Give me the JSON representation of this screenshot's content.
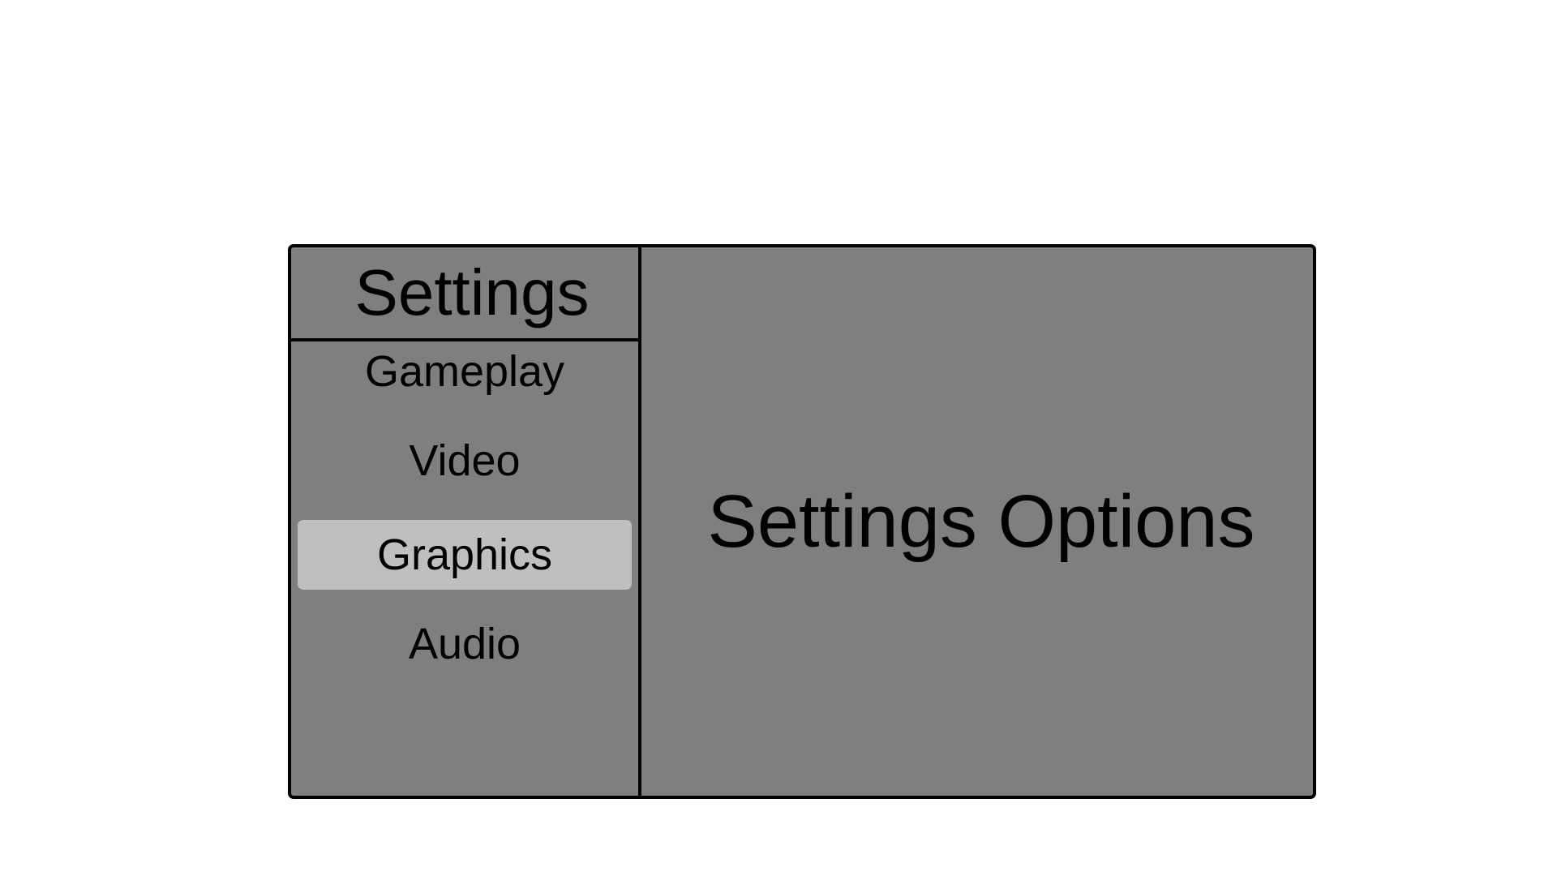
{
  "sidebar": {
    "title": "Settings",
    "items": [
      {
        "label": "Gameplay",
        "selected": false
      },
      {
        "label": "Video",
        "selected": false
      },
      {
        "label": "Graphics",
        "selected": true
      },
      {
        "label": "Audio",
        "selected": false
      }
    ]
  },
  "main": {
    "title": "Settings Options"
  },
  "colors": {
    "panel_background": "#7f7f7f",
    "selected_item_background": "#bfbfbf",
    "border": "#000000",
    "text": "#000000",
    "page_background": "#ffffff"
  }
}
